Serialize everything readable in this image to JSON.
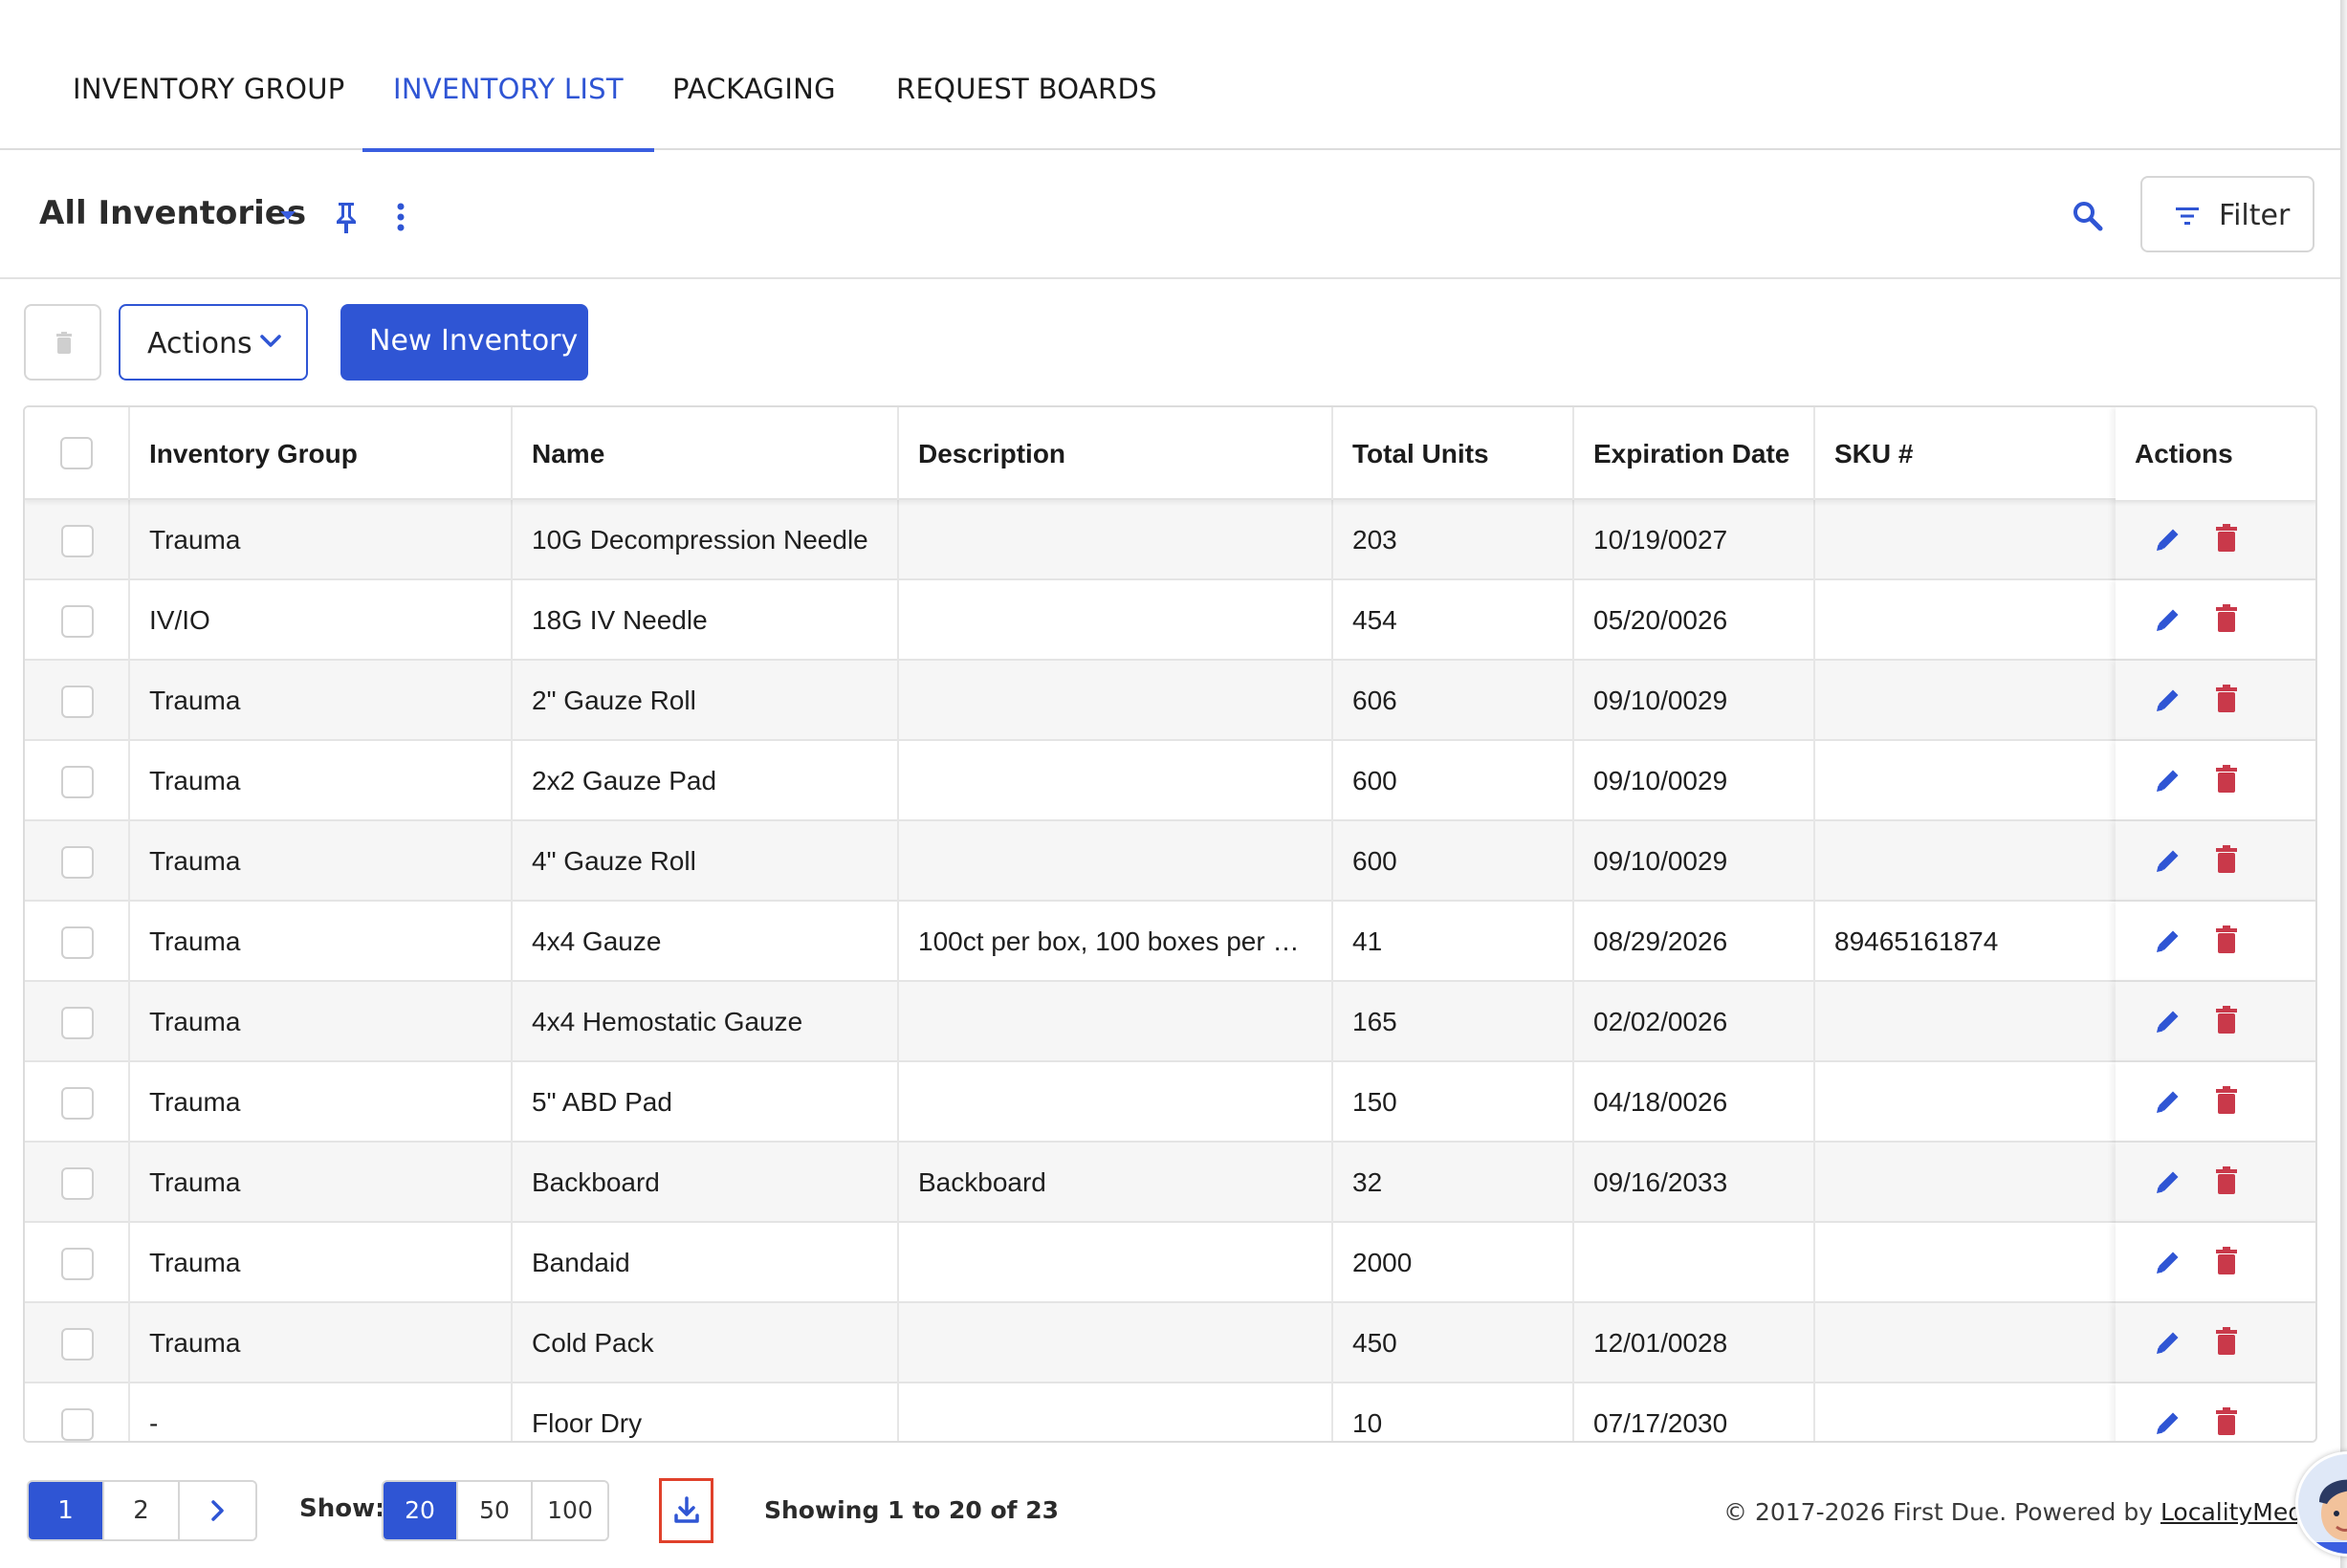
{
  "tabs": [
    {
      "label": "INVENTORY GROUP",
      "active": false
    },
    {
      "label": "INVENTORY LIST",
      "active": true
    },
    {
      "label": "PACKAGING",
      "active": false
    },
    {
      "label": "REQUEST BOARDS",
      "active": false
    }
  ],
  "header": {
    "title": "All Inventories",
    "filter_label": "Filter"
  },
  "toolbar": {
    "actions_label": "Actions",
    "new_label": "New Inventory"
  },
  "table": {
    "columns": [
      "Inventory Group",
      "Name",
      "Description",
      "Total Units",
      "Expiration Date",
      "SKU #",
      "Actions"
    ],
    "rows": [
      {
        "group": "Trauma",
        "name": "10G Decompression Needle",
        "description": "",
        "units": "203",
        "expiration": "10/19/0027",
        "sku": ""
      },
      {
        "group": "IV/IO",
        "name": "18G IV Needle",
        "description": "",
        "units": "454",
        "expiration": "05/20/0026",
        "sku": ""
      },
      {
        "group": "Trauma",
        "name": "2\" Gauze Roll",
        "description": "",
        "units": "606",
        "expiration": "09/10/0029",
        "sku": ""
      },
      {
        "group": "Trauma",
        "name": "2x2 Gauze Pad",
        "description": "",
        "units": "600",
        "expiration": "09/10/0029",
        "sku": ""
      },
      {
        "group": "Trauma",
        "name": "4\" Gauze Roll",
        "description": "",
        "units": "600",
        "expiration": "09/10/0029",
        "sku": ""
      },
      {
        "group": "Trauma",
        "name": "4x4 Gauze",
        "description": "100ct per box, 100 boxes per …",
        "units": "41",
        "expiration": "08/29/2026",
        "sku": "89465161874"
      },
      {
        "group": "Trauma",
        "name": "4x4 Hemostatic Gauze",
        "description": "",
        "units": "165",
        "expiration": "02/02/0026",
        "sku": ""
      },
      {
        "group": "Trauma",
        "name": "5\" ABD Pad",
        "description": "",
        "units": "150",
        "expiration": "04/18/0026",
        "sku": ""
      },
      {
        "group": "Trauma",
        "name": "Backboard",
        "description": "Backboard",
        "units": "32",
        "expiration": "09/16/2033",
        "sku": ""
      },
      {
        "group": "Trauma",
        "name": "Bandaid",
        "description": "",
        "units": "2000",
        "expiration": "",
        "sku": ""
      },
      {
        "group": "Trauma",
        "name": "Cold Pack",
        "description": "",
        "units": "450",
        "expiration": "12/01/0028",
        "sku": ""
      },
      {
        "group": "-",
        "name": "Floor Dry",
        "description": "",
        "units": "10",
        "expiration": "07/17/2030",
        "sku": ""
      }
    ]
  },
  "footer": {
    "pages": [
      "1",
      "2"
    ],
    "active_page": "1",
    "show_label": "Show:",
    "page_sizes": [
      "20",
      "50",
      "100"
    ],
    "active_size": "20",
    "showing_text": "Showing 1 to 20 of 23",
    "copyright_prefix": "© 2017-2026 First Due. Powered by ",
    "copyright_link": "LocalityMedia, Inc."
  },
  "colors": {
    "accent": "#2f55d4",
    "edit_icon": "#2f55d4",
    "delete_icon": "#c9394a",
    "download_highlight": "#e0412b"
  },
  "icons": {
    "dropdown": "caret-down-icon",
    "pin": "pin-icon",
    "more": "kebab-icon",
    "search": "search-icon",
    "filter": "filter-icon",
    "trash": "trash-icon",
    "edit": "pencil-icon",
    "next": "chevron-right-icon",
    "download": "download-icon"
  }
}
